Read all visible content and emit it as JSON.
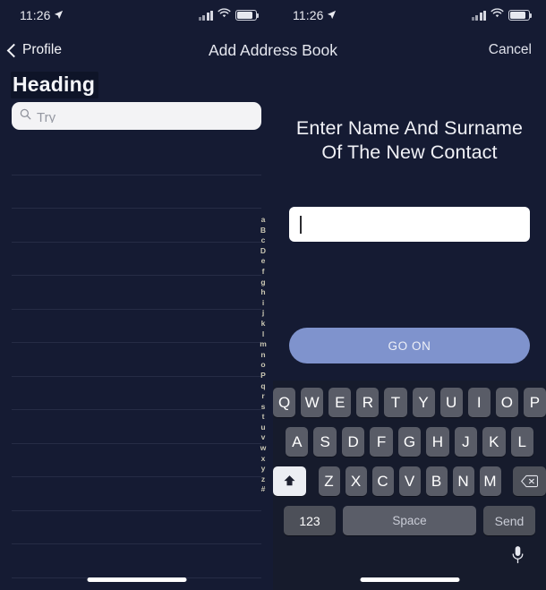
{
  "status_bar": {
    "time": "11:26",
    "location_icon": "location-arrow-icon",
    "signal_icon": "cellular-signal-icon",
    "wifi_icon": "wifi-icon",
    "battery_icon": "battery-icon"
  },
  "nav": {
    "back_label": "Profile",
    "back_icon": "chevron-left-icon",
    "title": "Add Address Book",
    "cancel_label": "Cancel"
  },
  "left_panel": {
    "heading": "Heading",
    "search": {
      "icon": "search-icon",
      "placeholder": "Try",
      "value": ""
    },
    "alpha_index": [
      "a",
      "B",
      "c",
      "D",
      "e",
      "f",
      "g",
      "h",
      "i",
      "j",
      "k",
      "l",
      "m",
      "n",
      "o",
      "P",
      "q",
      "r",
      "s",
      "t",
      "u",
      "v",
      "w",
      "x",
      "y",
      "z",
      "#"
    ],
    "list_rows": [
      "",
      "",
      "",
      "",
      "",
      "",
      "",
      "",
      "",
      "",
      "",
      "",
      ""
    ]
  },
  "right_panel": {
    "prompt": "Enter Name And Surname Of The New Contact",
    "name_input": {
      "value": "",
      "placeholder": ""
    },
    "primary_button": "GO ON"
  },
  "keyboard": {
    "row1": [
      "Q",
      "W",
      "E",
      "R",
      "T",
      "Y",
      "U",
      "I",
      "O",
      "P"
    ],
    "row2": [
      "A",
      "S",
      "D",
      "F",
      "G",
      "H",
      "J",
      "K",
      "L"
    ],
    "row3": [
      "Z",
      "X",
      "C",
      "V",
      "B",
      "N",
      "M"
    ],
    "shift_icon": "shift-up-arrow-icon",
    "delete_icon": "backspace-delete-icon",
    "numbers_label": "123",
    "space_label": "Space",
    "send_label": "Send",
    "mic_icon": "microphone-icon"
  },
  "colors": {
    "background": "#151b33",
    "accent_button": "#7f93cd",
    "key_face": "#595c67",
    "shift_active": "#eceef3",
    "search_field": "#f3f3f5",
    "index_letter": "#c9c6b3"
  }
}
